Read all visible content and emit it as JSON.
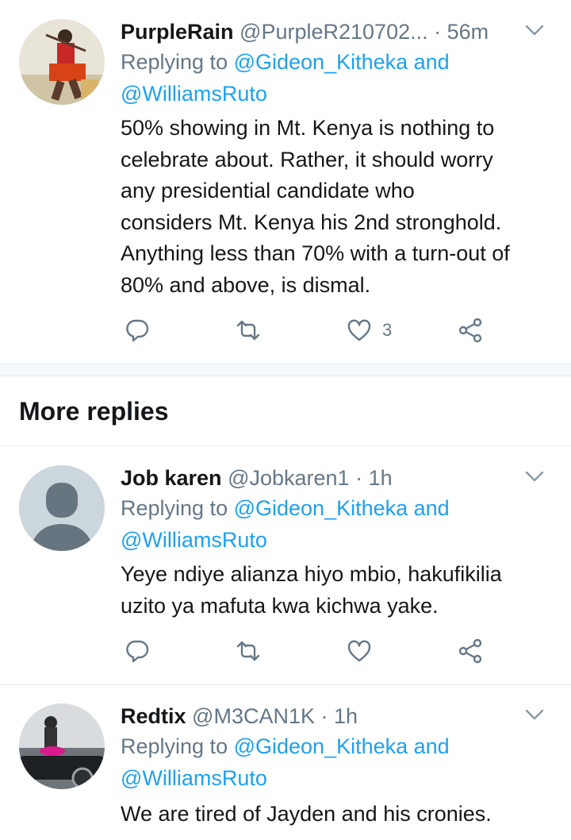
{
  "tweets": [
    {
      "name": "PurpleRain",
      "handle": "@PurpleR210702...",
      "dot": "·",
      "time": "56m",
      "replying_prefix": "Replying to ",
      "replying_user1": "@Gideon_Kitheka and",
      "replying_user2": "@WilliamsRuto",
      "lines": [
        "50% showing in Mt. Kenya is nothing to",
        "celebrate about. Rather, it should worry",
        "any presidential candidate who",
        "considers Mt. Kenya his 2nd stronghold.",
        "Anything less than 70% with a turn-out of",
        "80% and above, is dismal."
      ],
      "like_count": "3"
    },
    {
      "name": "Job karen",
      "handle": "@Jobkaren1",
      "dot": "·",
      "time": "1h",
      "replying_prefix": "Replying to ",
      "replying_user1": "@Gideon_Kitheka and",
      "replying_user2": "@WilliamsRuto",
      "lines": [
        "Yeye ndiye alianza hiyo mbio, hakufikilia",
        "uzito ya mafuta kwa kichwa yake."
      ],
      "like_count": ""
    },
    {
      "name": "Redtix",
      "handle": "@M3CAN1K",
      "dot": "·",
      "time": "1h",
      "replying_prefix": "Replying to ",
      "replying_user1": "@Gideon_Kitheka and",
      "replying_user2": "@WilliamsRuto",
      "lines": [
        "We are tired of Jayden and his cronies."
      ]
    }
  ],
  "section": {
    "more_replies": "More replies"
  },
  "icons": {
    "reply": "reply-icon",
    "retweet": "retweet-icon",
    "like": "heart-icon",
    "share": "share-icon",
    "caret": "chevron-down-icon"
  },
  "colors": {
    "link": "#1da1f2",
    "secondary": "#657786",
    "text": "#14171a"
  }
}
